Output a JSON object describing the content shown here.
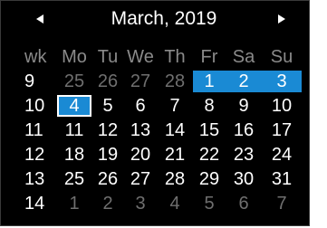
{
  "header": {
    "title": "March, 2019",
    "prev_icon": "triangle-left-icon",
    "next_icon": "triangle-right-icon"
  },
  "colors": {
    "background": "#000000",
    "selection": "#1a8ad4",
    "muted_text": "#6f6f6f",
    "header_text": "#8a8a8a"
  },
  "weekday_header": [
    "wk",
    "Mo",
    "Tu",
    "We",
    "Th",
    "Fr",
    "Sa",
    "Su"
  ],
  "weeks": [
    {
      "wk": "9",
      "days": [
        "25",
        "26",
        "27",
        "28",
        "1",
        "2",
        "3"
      ],
      "other": [
        true,
        true,
        true,
        true,
        false,
        false,
        false
      ],
      "selected": [
        false,
        false,
        false,
        false,
        true,
        true,
        true
      ],
      "current": -1
    },
    {
      "wk": "10",
      "days": [
        "4",
        "5",
        "6",
        "7",
        "8",
        "9",
        "10"
      ],
      "other": [
        false,
        false,
        false,
        false,
        false,
        false,
        false
      ],
      "selected": [
        false,
        false,
        false,
        false,
        false,
        false,
        false
      ],
      "current": 0
    },
    {
      "wk": "11",
      "days": [
        "11",
        "12",
        "13",
        "14",
        "15",
        "16",
        "17"
      ],
      "other": [
        false,
        false,
        false,
        false,
        false,
        false,
        false
      ],
      "selected": [
        false,
        false,
        false,
        false,
        false,
        false,
        false
      ],
      "current": -1
    },
    {
      "wk": "12",
      "days": [
        "18",
        "19",
        "20",
        "21",
        "22",
        "23",
        "24"
      ],
      "other": [
        false,
        false,
        false,
        false,
        false,
        false,
        false
      ],
      "selected": [
        false,
        false,
        false,
        false,
        false,
        false,
        false
      ],
      "current": -1
    },
    {
      "wk": "13",
      "days": [
        "25",
        "26",
        "27",
        "28",
        "29",
        "30",
        "31"
      ],
      "other": [
        false,
        false,
        false,
        false,
        false,
        false,
        false
      ],
      "selected": [
        false,
        false,
        false,
        false,
        false,
        false,
        false
      ],
      "current": -1
    },
    {
      "wk": "14",
      "days": [
        "1",
        "2",
        "3",
        "4",
        "5",
        "6",
        "7"
      ],
      "other": [
        true,
        true,
        true,
        true,
        true,
        true,
        true
      ],
      "selected": [
        false,
        false,
        false,
        false,
        false,
        false,
        false
      ],
      "current": -1
    }
  ]
}
